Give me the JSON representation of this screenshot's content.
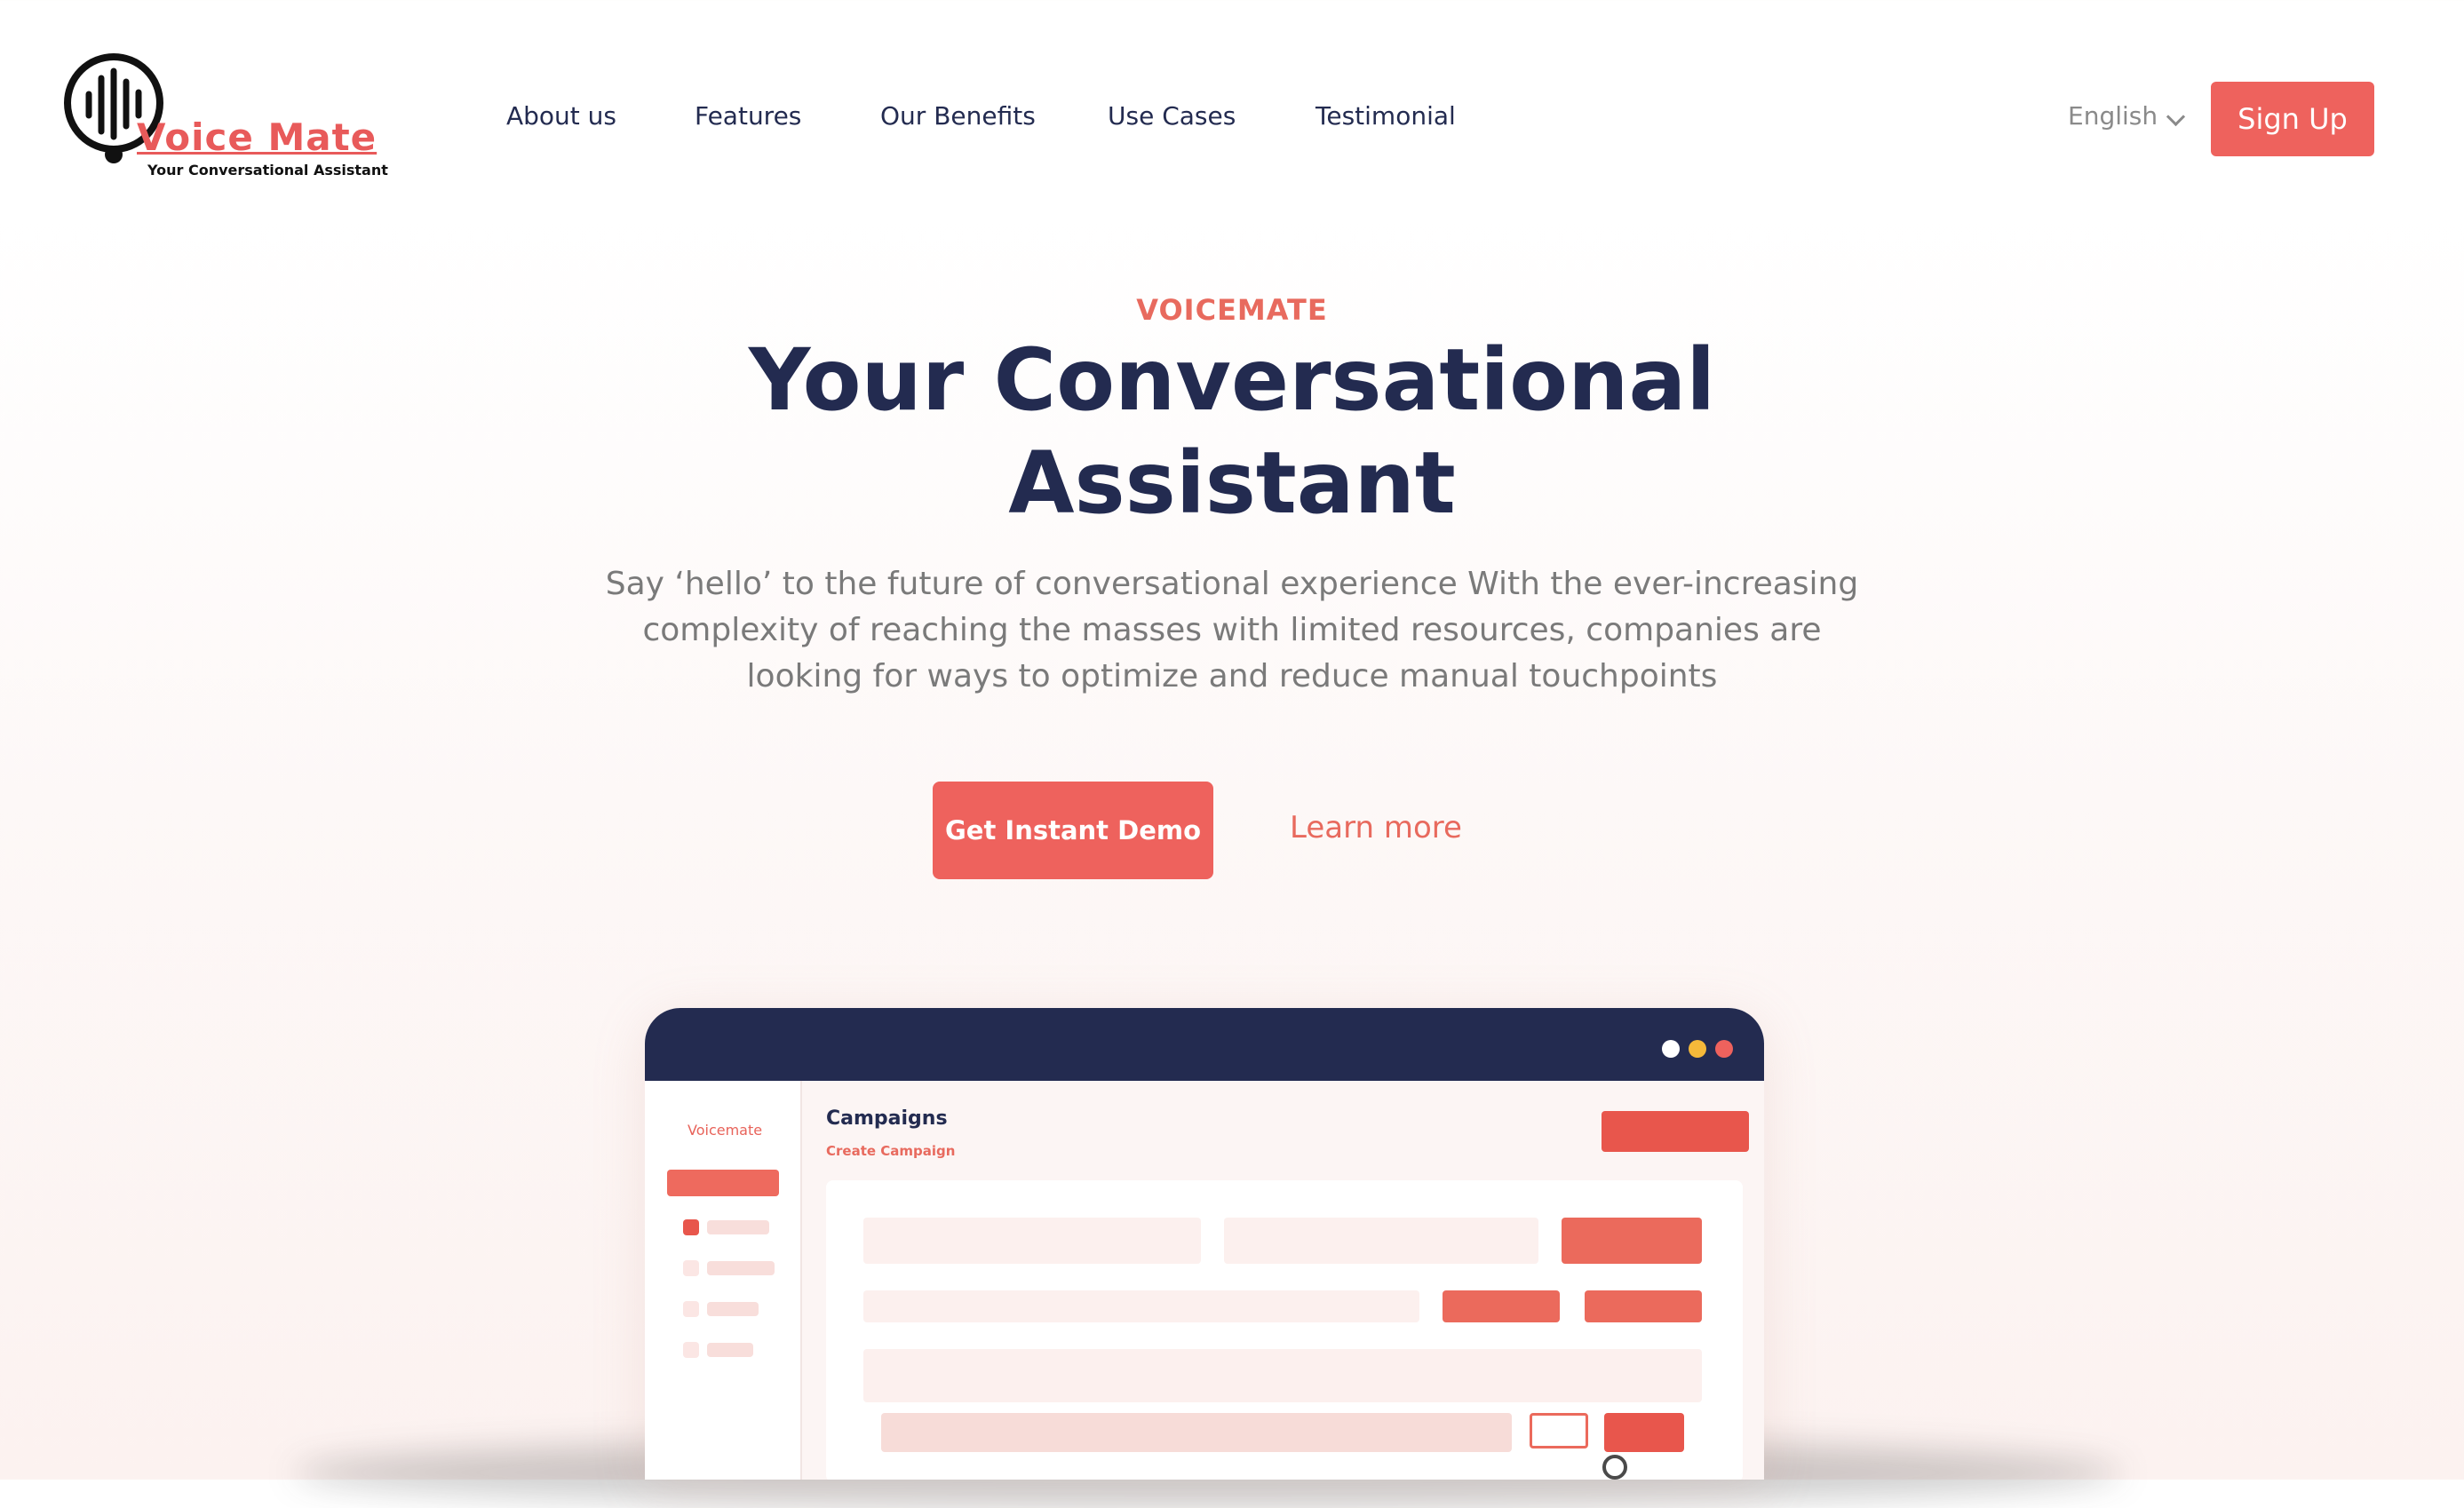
{
  "brand": {
    "name": "Voice Mate",
    "tagline": "Your Conversational Assistant",
    "icon": "microphone-wave-icon"
  },
  "nav": {
    "items": [
      {
        "label": "About us"
      },
      {
        "label": "Features"
      },
      {
        "label": "Our Benefits"
      },
      {
        "label": "Use Cases"
      },
      {
        "label": "Testimonial"
      }
    ],
    "language": "English",
    "signup_label": "Sign Up"
  },
  "hero": {
    "eyebrow": "VOICEMATE",
    "title_line1": "Your Conversational",
    "title_line2": "Assistant",
    "subtitle_line1": "Say ‘hello’ to the future of conversational experience With the ever-increasing",
    "subtitle_line2": "complexity of reaching the masses with limited resources, companies are",
    "subtitle_line3": "looking for ways to optimize and reduce manual touchpoints",
    "primary_cta": "Get Instant Demo",
    "secondary_cta": "Learn more"
  },
  "mockup": {
    "brand": "Voicemate",
    "title": "Campaigns",
    "subtitle": "Create Campaign",
    "window_dots": [
      "#ffffff",
      "#f5b93a",
      "#ee625d"
    ]
  },
  "colors": {
    "accent": "#ee625d",
    "navy": "#232b50",
    "muted_text": "#7a7a7a"
  }
}
